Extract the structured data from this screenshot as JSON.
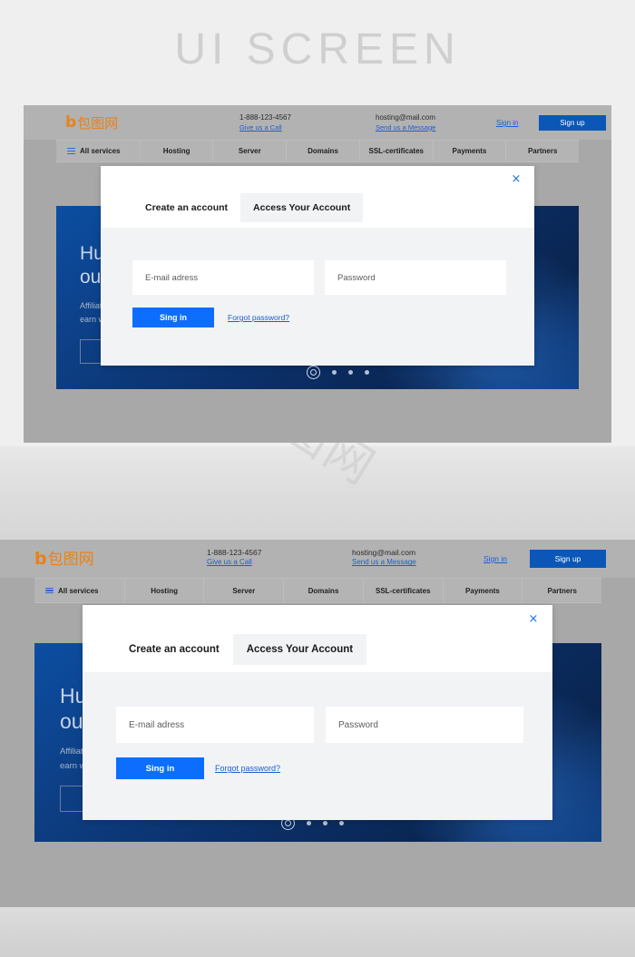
{
  "page": {
    "watermark_title": "UI SCREEN",
    "watermark_mark": "包图网",
    "accent_blue": "#0d6efd",
    "brand_orange": "#e8821a",
    "header_blue": "#0b57b8"
  },
  "site": {
    "logo": {
      "mark": "b",
      "name": "包图网"
    },
    "contact_phone": {
      "value": "1-888-123-4567",
      "link": "Give us a Call"
    },
    "contact_email": {
      "value": "hosting@mail.com",
      "link": "Send us a Message"
    },
    "sign_in_label": "Sign in",
    "sign_up_label": "Sign up",
    "nav": [
      {
        "label": "All services",
        "icon": "hamburger-icon"
      },
      {
        "label": "Hosting"
      },
      {
        "label": "Server"
      },
      {
        "label": "Domains"
      },
      {
        "label": "SSL-certificates"
      },
      {
        "label": "Payments"
      },
      {
        "label": "Partners"
      }
    ]
  },
  "hero": {
    "title_line1": "Hub",
    "title_line2": "our",
    "sub_line1": "Affiliate",
    "sub_line2": "earn w",
    "button_label": "",
    "carousel": {
      "total": 4,
      "active_index": 0
    }
  },
  "modal": {
    "close_icon": "×",
    "tabs": [
      {
        "label": "Create an account",
        "active": false
      },
      {
        "label": "Access Your Account",
        "active": true
      }
    ],
    "email_placeholder": "E-mail adress",
    "password_placeholder": "Password",
    "submit_label": "Sing in",
    "forgot_label": "Forgot password?"
  }
}
